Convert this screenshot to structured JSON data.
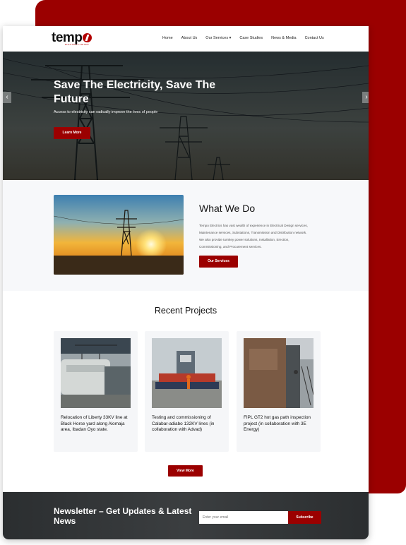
{
  "header": {
    "logo": "tempo",
    "logo_sub": "ELECTRIC LIMITED",
    "nav": [
      "Home",
      "About Us",
      "Our Services ▾",
      "Case Studies",
      "News & Media",
      "Contact Us"
    ]
  },
  "hero": {
    "title": "Save The Electricity, Save The Future",
    "subtitle": "Access to electricity can radically improve the lives of people",
    "button": "Learn More",
    "prev_arrow": "‹",
    "next_arrow": "›"
  },
  "what_we_do": {
    "title": "What We Do",
    "text": "Tempo Electrics has vast wealth of experience in Electrical Design services, Maintenance services, Substations, Transmission and Distribution network. We also provide turnkey power solutions, Installation, Erection, Commissioning, and Procurement services.",
    "button": "Our Services"
  },
  "projects": {
    "title": "Recent Projects",
    "items": [
      {
        "title": "Relocation of Liberty 33KV line at Black Horse yard along Alomaja area, Ibadan Oyo state."
      },
      {
        "title": "Testing and commissioning of Calabar-adiabo 132KV lines (in collaboration with Advad)"
      },
      {
        "title": "FIPL GT2 hot gas path inspection project (in collaboration with 3E Energy)"
      }
    ],
    "button": "View More"
  },
  "newsletter": {
    "title": "Newsletter – Get Updates & Latest News",
    "placeholder": "Enter your email",
    "button": "Subscribe"
  },
  "colors": {
    "brand_red": "#9b0000",
    "dark": "#2b2e30"
  }
}
